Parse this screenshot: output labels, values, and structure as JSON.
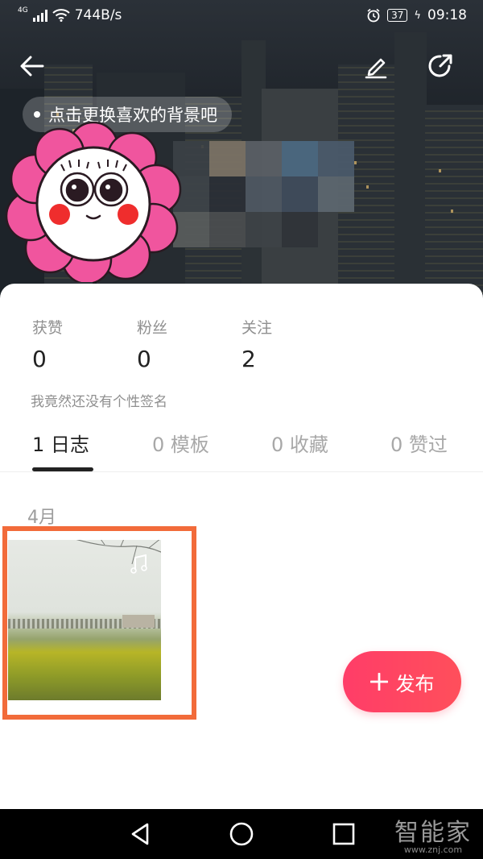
{
  "status_bar": {
    "network_type": "4G",
    "speed": "744B/s",
    "battery": "37",
    "time": "09:18"
  },
  "header": {
    "back_icon": "arrow-left-icon",
    "edit_icon": "pencil-icon",
    "share_icon": "share-arrow-icon",
    "tip_text": "点击更换喜欢的背景吧"
  },
  "profile": {
    "stats": [
      {
        "label": "获赞",
        "value": "0"
      },
      {
        "label": "粉丝",
        "value": "0"
      },
      {
        "label": "关注",
        "value": "2"
      }
    ],
    "bio": "我竟然还没有个性签名"
  },
  "tabs": [
    {
      "label": "1 日志",
      "active": true
    },
    {
      "label": "0 模板",
      "active": false
    },
    {
      "label": "0 收藏",
      "active": false
    },
    {
      "label": "0 赞过",
      "active": false
    }
  ],
  "feed": {
    "month": "4月",
    "entry_icon": "music-note-icon"
  },
  "publish_button": {
    "label": "发布",
    "icon": "plus-icon"
  },
  "colors": {
    "accent": "#ff4462",
    "highlight_frame": "#f26b3a"
  },
  "watermark": {
    "brand": "智能家",
    "url": "www.znj.com"
  }
}
